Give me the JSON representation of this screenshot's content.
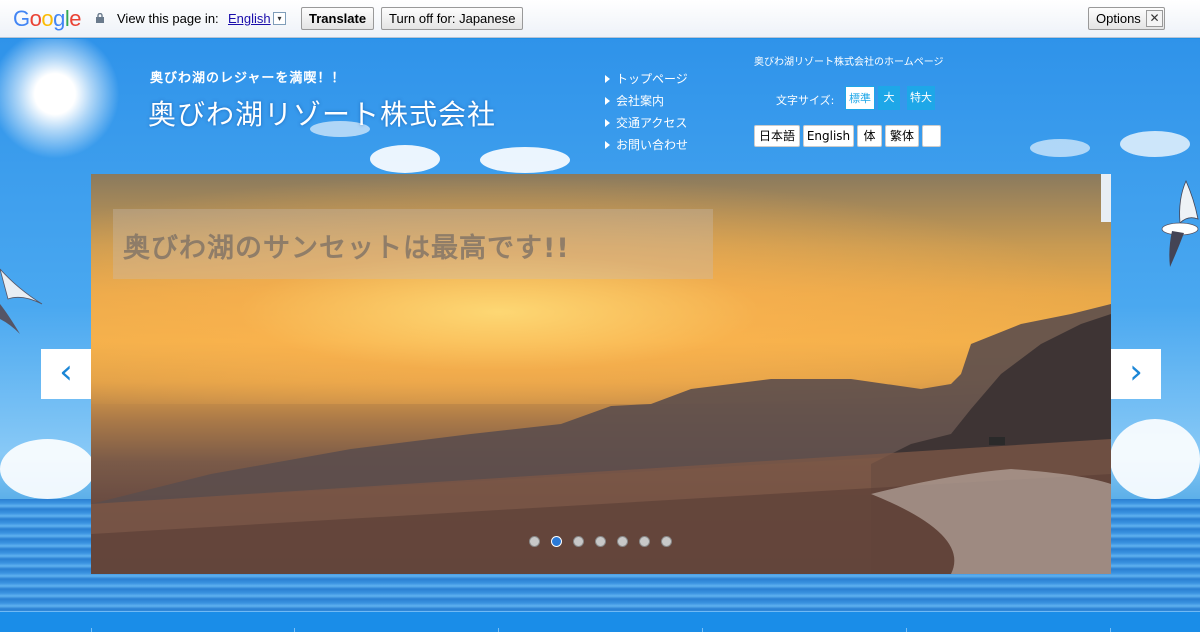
{
  "translate_bar": {
    "logo": "Google",
    "view_text": "View this page in:",
    "language": "English",
    "dropdown_glyph": "▾",
    "translate_label": "Translate",
    "turn_off_label": "Turn off for: Japanese",
    "options_label": "Options ▼",
    "close_glyph": "✕"
  },
  "header": {
    "tagline": "奥びわ湖のレジャーを満喫！！",
    "site_name": "奥びわ湖リゾート株式会社",
    "home_label": "奥びわ湖リゾート株式会社のホームページ"
  },
  "nav": {
    "items": [
      {
        "label": "トップページ"
      },
      {
        "label": "会社案内"
      },
      {
        "label": "交通アクセス"
      },
      {
        "label": "お問い合わせ"
      }
    ]
  },
  "font_size": {
    "label": "文字サイズ:",
    "options": [
      "標準",
      "大",
      "特大"
    ],
    "selected": "標準"
  },
  "languages": [
    "日本語",
    "English",
    "体",
    "繁体",
    ""
  ],
  "slider": {
    "caption": "奥びわ湖のサンセットは最高です!!",
    "prev_glyph": "‹",
    "next_glyph": "›",
    "active_dot_index": 1,
    "dot_count": 7
  },
  "colors": {
    "accent": "#1ea7e8",
    "link": "#1a0dab",
    "footer": "#1a8de8"
  }
}
